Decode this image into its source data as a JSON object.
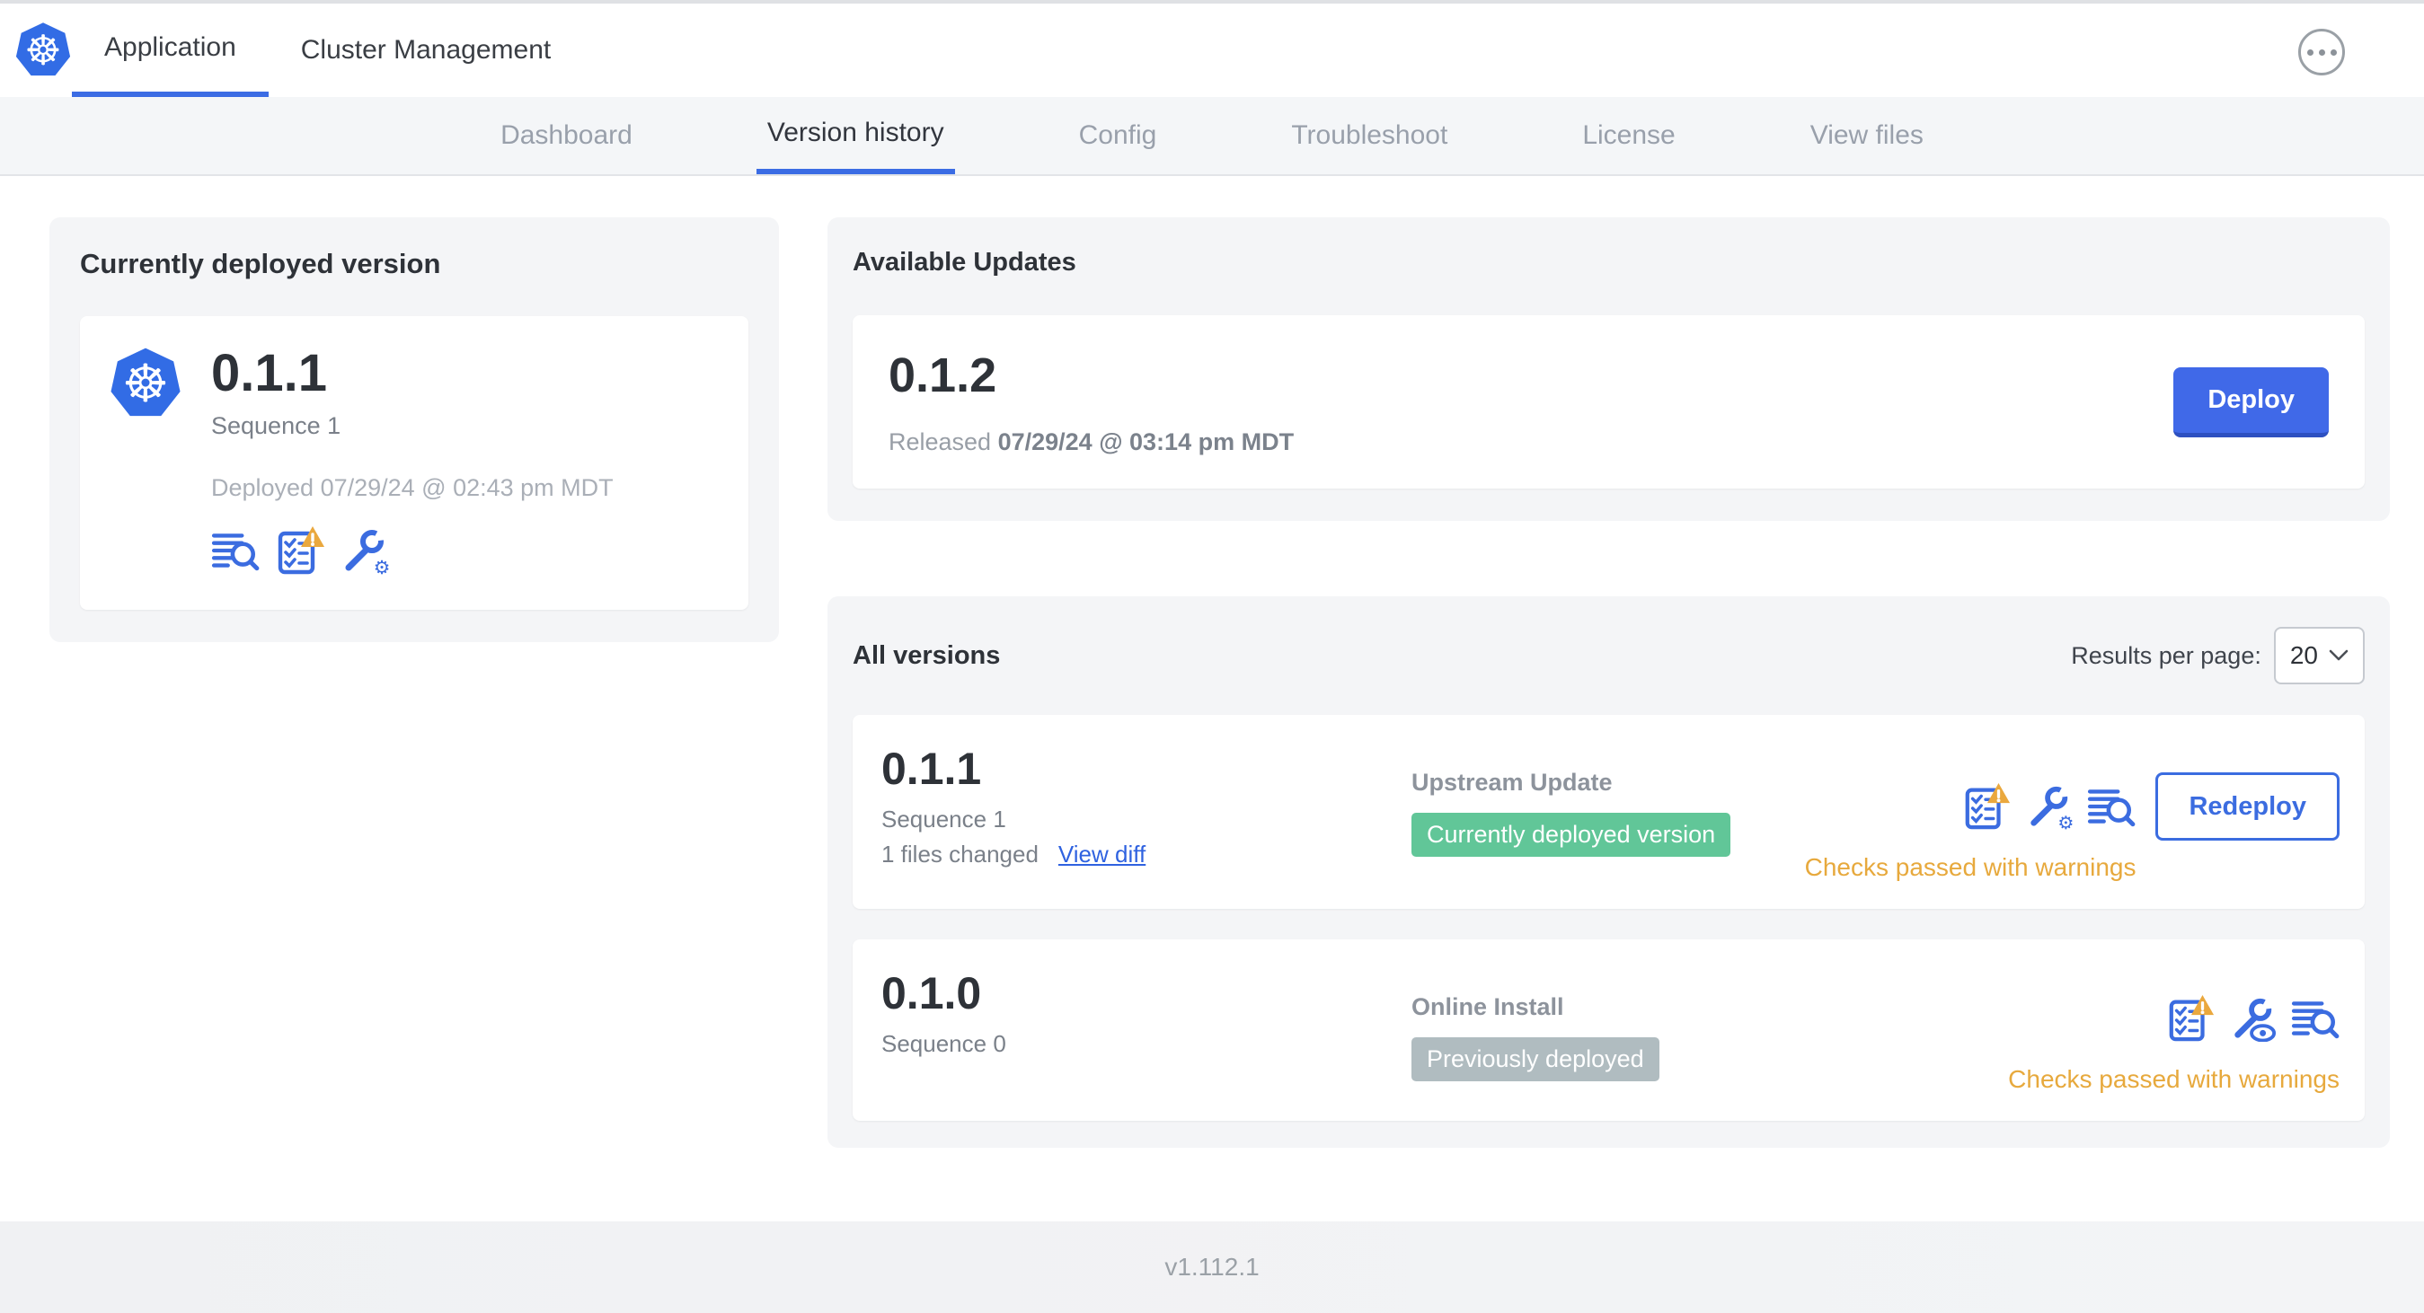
{
  "colors": {
    "accent_blue": "#3b6ce0",
    "k8s_blue": "#326ce5",
    "deploy_button": "#4069e8",
    "green_badge": "#61c698",
    "gray_badge": "#b0bcc0",
    "warning_orange": "#e7a93d"
  },
  "icons": {
    "kubernetes-logo": "☸",
    "ellipsis-menu": "•••",
    "chevron-down": "⌄",
    "file-diff": "lines+magnifier",
    "preflight-checklist": "checklist+warning-triangle",
    "edit-config": "wrench+gear",
    "view-config": "wrench+eye"
  },
  "header": {
    "tabs": [
      {
        "label": "Application"
      },
      {
        "label": "Cluster Management"
      }
    ]
  },
  "subnav": {
    "active": "Version history",
    "tabs": [
      "Dashboard",
      "Version history",
      "Config",
      "Troubleshoot",
      "License",
      "View files"
    ]
  },
  "current_version": {
    "title": "Currently deployed version",
    "version": "0.1.1",
    "sequence": "Sequence 1",
    "deployed": "Deployed 07/29/24 @ 02:43 pm MDT"
  },
  "available_updates": {
    "title": "Available Updates",
    "version": "0.1.2",
    "released_label": "Released",
    "released_date": "07/29/24 @ 03:14 pm MDT",
    "deploy_label": "Deploy"
  },
  "all_versions": {
    "title": "All versions",
    "results_label": "Results per page:",
    "results_value": "20",
    "rows": [
      {
        "version": "0.1.1",
        "sequence": "Sequence 1",
        "files_changed": "1 files changed",
        "view_diff_label": "View diff",
        "source": "Upstream Update",
        "badge_label": "Currently deployed version",
        "badge_style": "background:#61c698",
        "status": "Checks passed with warnings",
        "action_label": "Redeploy"
      },
      {
        "version": "0.1.0",
        "sequence": "Sequence 0",
        "source": "Online Install",
        "badge_label": "Previously deployed",
        "badge_style": "background:#b0bcc0",
        "status": "Checks passed with warnings"
      }
    ]
  },
  "footer": {
    "version_label": "v1.112.1"
  }
}
